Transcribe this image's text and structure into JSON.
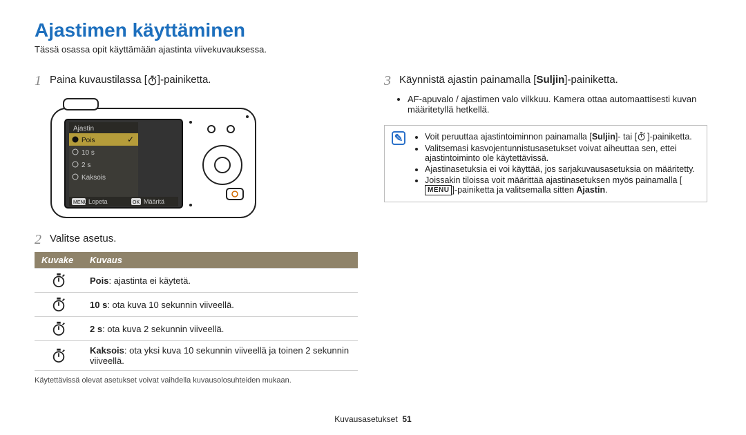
{
  "title": "Ajastimen käyttäminen",
  "intro": "Tässä osassa opit käyttämään ajastinta viivekuvauksessa.",
  "left": {
    "step1": {
      "num": "1",
      "text_before": "Paina kuvaustilassa [",
      "text_after": "]-painiketta."
    },
    "step2": {
      "num": "2",
      "text": "Valitse asetus."
    },
    "table": {
      "h_icon": "Kuvake",
      "h_desc": "Kuvaus",
      "rows": [
        {
          "bold": "Pois",
          "rest": ": ajastinta ei käytetä."
        },
        {
          "bold": "10 s",
          "rest": ": ota kuva 10 sekunnin viiveellä."
        },
        {
          "bold": "2 s",
          "rest": ": ota kuva 2 sekunnin viiveellä."
        },
        {
          "bold": "Kaksois",
          "rest": ": ota yksi kuva 10 sekunnin viiveellä ja toinen 2 sekunnin viiveellä."
        }
      ]
    },
    "table_foot": "Käytettävissä olevat asetukset voivat vaihdella kuvausolosuhteiden mukaan.",
    "camera_menu": {
      "title": "Ajastin",
      "items": [
        "Pois",
        "10 s",
        "2 s",
        "Kaksois"
      ],
      "foot_left": "Lopeta",
      "foot_right": "Määritä",
      "menu_label": "MENU",
      "ok_label": "OK"
    }
  },
  "right": {
    "step3": {
      "num": "3",
      "text_before": "Käynnistä ajastin painamalla [",
      "bold": "Suljin",
      "text_after": "]-painiketta."
    },
    "bullets": [
      "AF-apuvalo / ajastimen valo vilkkuu. Kamera ottaa automaattisesti kuvan määritetyllä hetkellä."
    ],
    "note": {
      "item1_a": "Voit peruuttaa ajastintoiminnon painamalla [",
      "item1_bold": "Suljin",
      "item1_b": "]- tai [",
      "item1_c": "]-painiketta.",
      "item2": "Valitsemasi kasvojentunnistusasetukset voivat aiheuttaa sen, ettei ajastintoiminto ole käytettävissä.",
      "item3": "Ajastinasetuksia ei voi käyttää, jos sarjakuvausasetuksia on määritetty.",
      "item4_a": "Joissakin tiloissa voit määrittää ajastinasetuksen myös painamalla [",
      "item4_b": "]-painiketta ja valitsemalla sitten ",
      "item4_bold": "Ajastin",
      "item4_c": ".",
      "menu_label": "MENU"
    }
  },
  "footer": {
    "section": "Kuvausasetukset",
    "page": "51"
  },
  "chart_data": {
    "type": "table",
    "title": "Ajastin-asetukset",
    "categories": [
      "Pois",
      "10 s",
      "2 s",
      "Kaksois"
    ],
    "values_sec": [
      0,
      10,
      2,
      null
    ],
    "descriptions": [
      "ajastinta ei käytetä",
      "ota kuva 10 sekunnin viiveellä",
      "ota kuva 2 sekunnin viiveellä",
      "ota yksi kuva 10 sekunnin viiveellä ja toinen 2 sekunnin viiveellä"
    ]
  }
}
